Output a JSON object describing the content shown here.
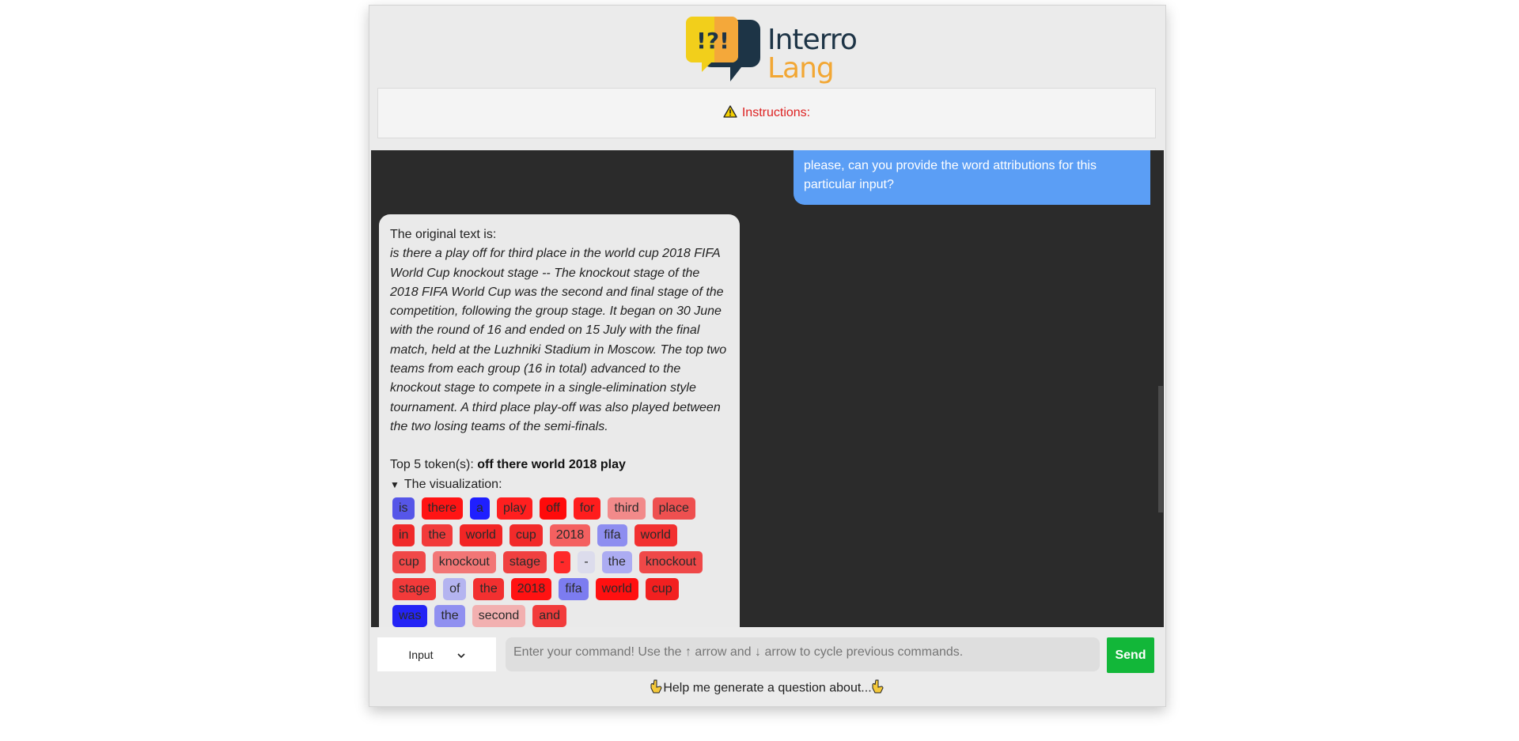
{
  "header": {
    "logo_symbol": "!?!",
    "logo_line1": "Interro",
    "logo_line2": "Lang",
    "instructions_label": "Instructions:"
  },
  "chat": {
    "user_message": "please, can you provide the word attributions for this particular input?",
    "bot": {
      "intro": "The original text is:",
      "original_text": "is there a play off for third place in the world cup 2018 FIFA World Cup knockout stage -- The knockout stage of the 2018 FIFA World Cup was the second and final stage of the competition, following the group stage. It began on 30 June with the round of 16 and ended on 15 July with the final match, held at the Luzhniki Stadium in Moscow. The top two teams from each group (16 in total) advanced to the knockout stage to compete in a single-elimination style tournament. A third place play-off was also played between the two losing teams of the semi-finals.",
      "top_tokens_label": "Top 5 token(s):",
      "top_tokens": "off there world 2018 play",
      "viz_label": "The visualization:",
      "tokens": [
        {
          "text": "is",
          "color": "#5656e8"
        },
        {
          "text": "there",
          "color": "#ff1414"
        },
        {
          "text": "a",
          "color": "#1f1fff"
        },
        {
          "text": "play",
          "color": "#ff1f1f"
        },
        {
          "text": "off",
          "color": "#ff0a0a"
        },
        {
          "text": "for",
          "color": "#ff1d1d"
        },
        {
          "text": "third",
          "color": "#f28a8a"
        },
        {
          "text": "place",
          "color": "#ee5050"
        },
        {
          "text": "in",
          "color": "#f02a2a"
        },
        {
          "text": "the",
          "color": "#f23a3a"
        },
        {
          "text": "world",
          "color": "#f22525"
        },
        {
          "text": "cup",
          "color": "#f22a2a"
        },
        {
          "text": "2018",
          "color": "#f46060"
        },
        {
          "text": "fifa",
          "color": "#8e8ef0"
        },
        {
          "text": "world",
          "color": "#f23030"
        },
        {
          "text": "cup",
          "color": "#f04848"
        },
        {
          "text": "knockout",
          "color": "#f27676"
        },
        {
          "text": "stage",
          "color": "#f04040"
        },
        {
          "text": "-",
          "color": "#ff2a2a"
        },
        {
          "text": "-",
          "color": "#dcdcec"
        },
        {
          "text": "the",
          "color": "#acacf2"
        },
        {
          "text": "knockout",
          "color": "#ef4848"
        },
        {
          "text": "stage",
          "color": "#f23a3a"
        },
        {
          "text": "of",
          "color": "#b4b4f0"
        },
        {
          "text": "the",
          "color": "#f23030"
        },
        {
          "text": "2018",
          "color": "#ff1212"
        },
        {
          "text": "fifa",
          "color": "#7c7cf0"
        },
        {
          "text": "world",
          "color": "#ff1010"
        },
        {
          "text": "cup",
          "color": "#f22020"
        },
        {
          "text": "was",
          "color": "#2424f5"
        },
        {
          "text": "the",
          "color": "#9090f0"
        },
        {
          "text": "second",
          "color": "#f2b0b0"
        },
        {
          "text": "and",
          "color": "#f23c3c"
        }
      ]
    }
  },
  "input_bar": {
    "mode_selected": "Input",
    "placeholder": "Enter your command! Use the ↑ arrow and ↓ arrow to cycle previous commands.",
    "send_label": "Send"
  },
  "help": {
    "text": "Help me generate a question about..."
  },
  "colors": {
    "accent_send": "#12b739",
    "user_bubble": "#5b9ef5",
    "chat_bg": "#2b2b2b",
    "instructions": "#dd2222"
  }
}
